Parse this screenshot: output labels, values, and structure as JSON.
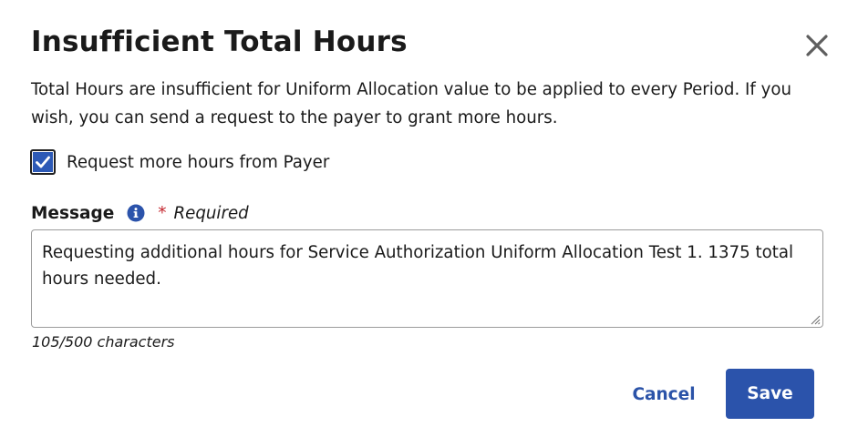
{
  "dialog": {
    "title": "Insufficient Total Hours",
    "description": "Total Hours are insufficient for Uniform Allocation value to be applied to every Period. If you wish, you can send a request to the payer to grant more hours.",
    "close_icon": "close-icon"
  },
  "checkbox": {
    "label": "Request more hours from Payer",
    "checked": true,
    "icon": "checkmark-icon"
  },
  "message_field": {
    "label": "Message",
    "info_icon": "info-icon",
    "required_marker": "*",
    "required_text": "Required",
    "value": "Requesting additional hours for Service Authorization Uniform Allocation Test 1. 1375 total hours needed.",
    "char_count": "105/500 characters"
  },
  "actions": {
    "cancel_label": "Cancel",
    "save_label": "Save"
  },
  "colors": {
    "primary": "#2b53ab",
    "link": "#2b53a8",
    "required": "#c4262e",
    "text": "#1a1a1a"
  }
}
